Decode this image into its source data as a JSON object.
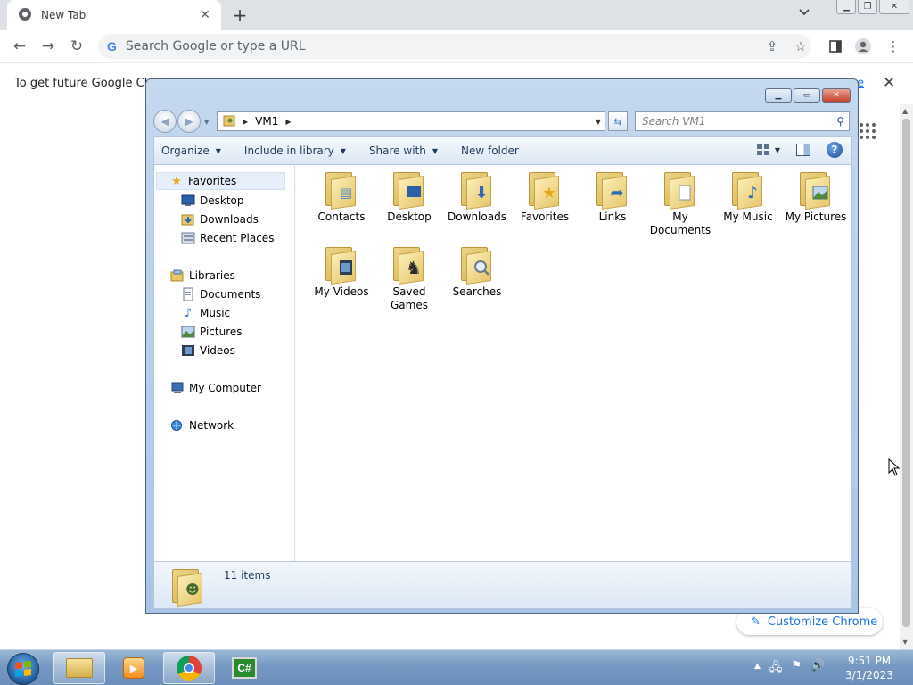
{
  "chrome": {
    "tab_title": "New Tab",
    "omnibox_placeholder": "Search Google or type a URL",
    "info_bar_text": "To get future Google Chro",
    "info_bar_link": "re",
    "customize_label": "Customize Chrome"
  },
  "explorer": {
    "address_crumb": "VM1",
    "search_placeholder": "Search VM1",
    "commands": {
      "organize": "Organize",
      "include_in_library": "Include in library",
      "share_with": "Share with",
      "new_folder": "New folder"
    },
    "nav": {
      "favorites": "Favorites",
      "desktop": "Desktop",
      "downloads": "Downloads",
      "recent_places": "Recent Places",
      "libraries": "Libraries",
      "documents": "Documents",
      "music": "Music",
      "pictures": "Pictures",
      "videos": "Videos",
      "my_computer": "My Computer",
      "network": "Network"
    },
    "items": [
      {
        "label": "Contacts",
        "icon": "contacts-icon"
      },
      {
        "label": "Desktop",
        "icon": "desktop-icon"
      },
      {
        "label": "Downloads",
        "icon": "download-arrow-icon"
      },
      {
        "label": "Favorites",
        "icon": "star-icon"
      },
      {
        "label": "Links",
        "icon": "link-arrow-icon"
      },
      {
        "label": "My Documents",
        "icon": "documents-icon"
      },
      {
        "label": "My Music",
        "icon": "music-note-icon"
      },
      {
        "label": "My Pictures",
        "icon": "picture-icon"
      },
      {
        "label": "My Videos",
        "icon": "film-icon"
      },
      {
        "label": "Saved Games",
        "icon": "chess-icon"
      },
      {
        "label": "Searches",
        "icon": "magnifier-icon"
      }
    ],
    "item_count": "11 items"
  },
  "taskbar": {
    "time": "9:51 PM",
    "date": "3/1/2023",
    "cs_label": "C#"
  }
}
